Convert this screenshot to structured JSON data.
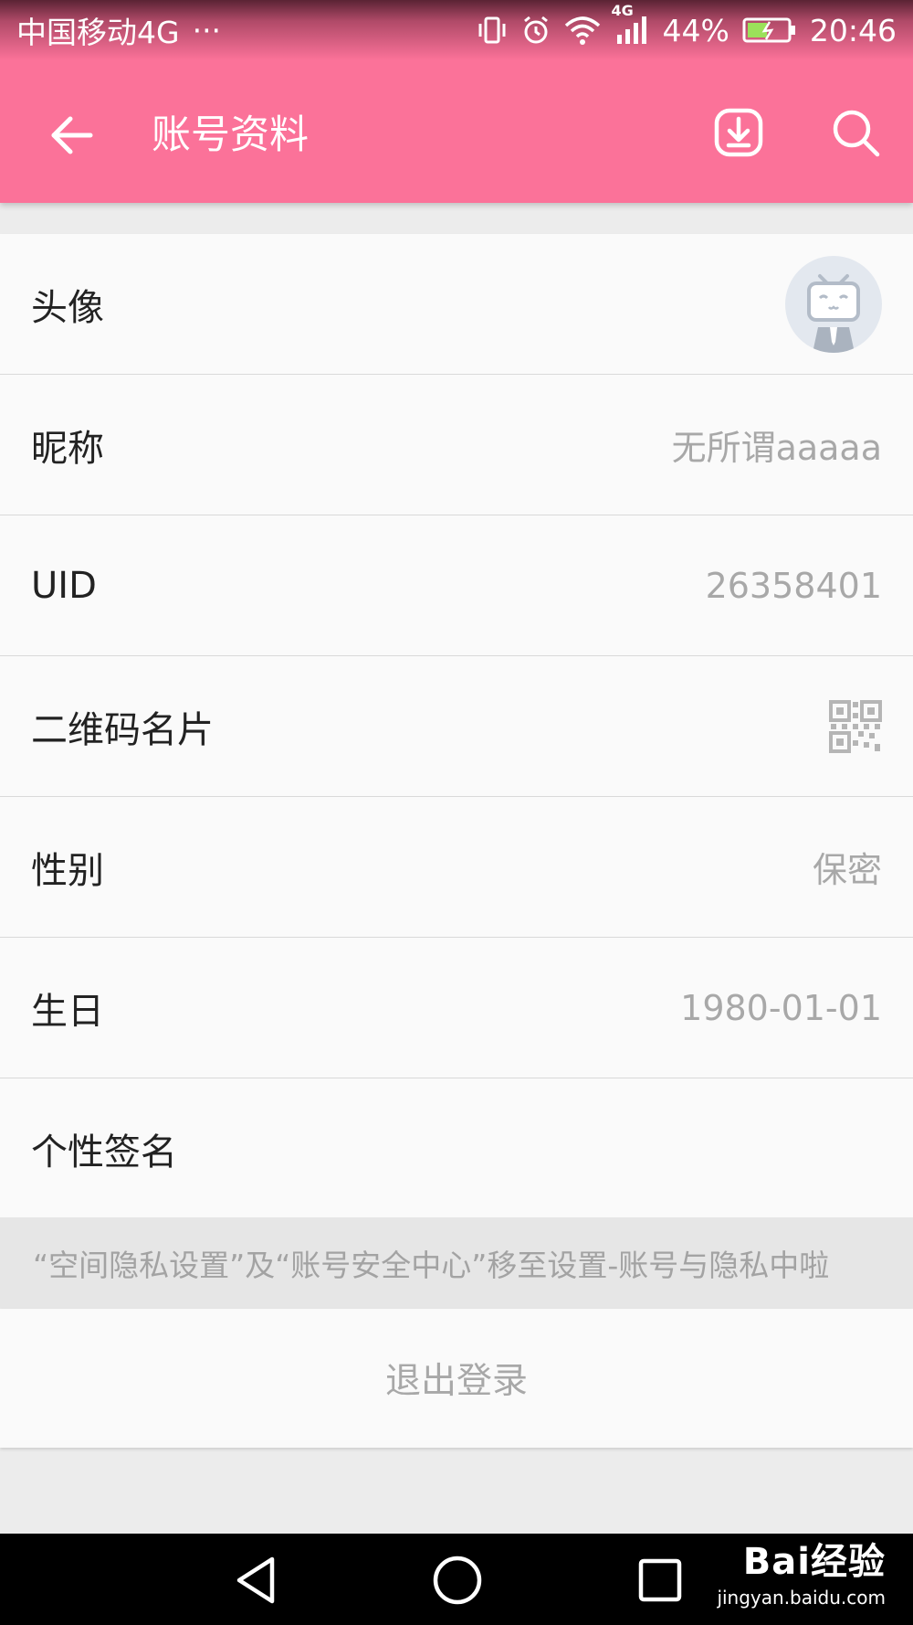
{
  "status_bar": {
    "carrier": "中国移动4G",
    "more": "···",
    "network": "4G",
    "battery": "44%",
    "time": "20:46"
  },
  "app_bar": {
    "title": "账号资料",
    "icons": [
      "back-arrow-icon",
      "download-icon",
      "search-icon"
    ]
  },
  "profile": {
    "rows": [
      {
        "label": "头像",
        "value": ""
      },
      {
        "label": "昵称",
        "value": "无所谓aaaaa"
      },
      {
        "label": "UID",
        "value": "26358401"
      },
      {
        "label": "二维码名片",
        "value": ""
      },
      {
        "label": "性别",
        "value": "保密"
      },
      {
        "label": "生日",
        "value": "1980-01-01"
      },
      {
        "label": "个性签名",
        "value": ""
      }
    ]
  },
  "notice": "“空间隐私设置”及“账号安全中心”移至设置-账号与隐私中啦",
  "logout_label": "退出登录",
  "watermark": {
    "brand": "Bai经验",
    "url": "jingyan.baidu.com"
  },
  "colors": {
    "accent": "#fb7299",
    "background": "#ececec",
    "row_bg": "#fafafa",
    "value_text": "#a8a8a8"
  }
}
